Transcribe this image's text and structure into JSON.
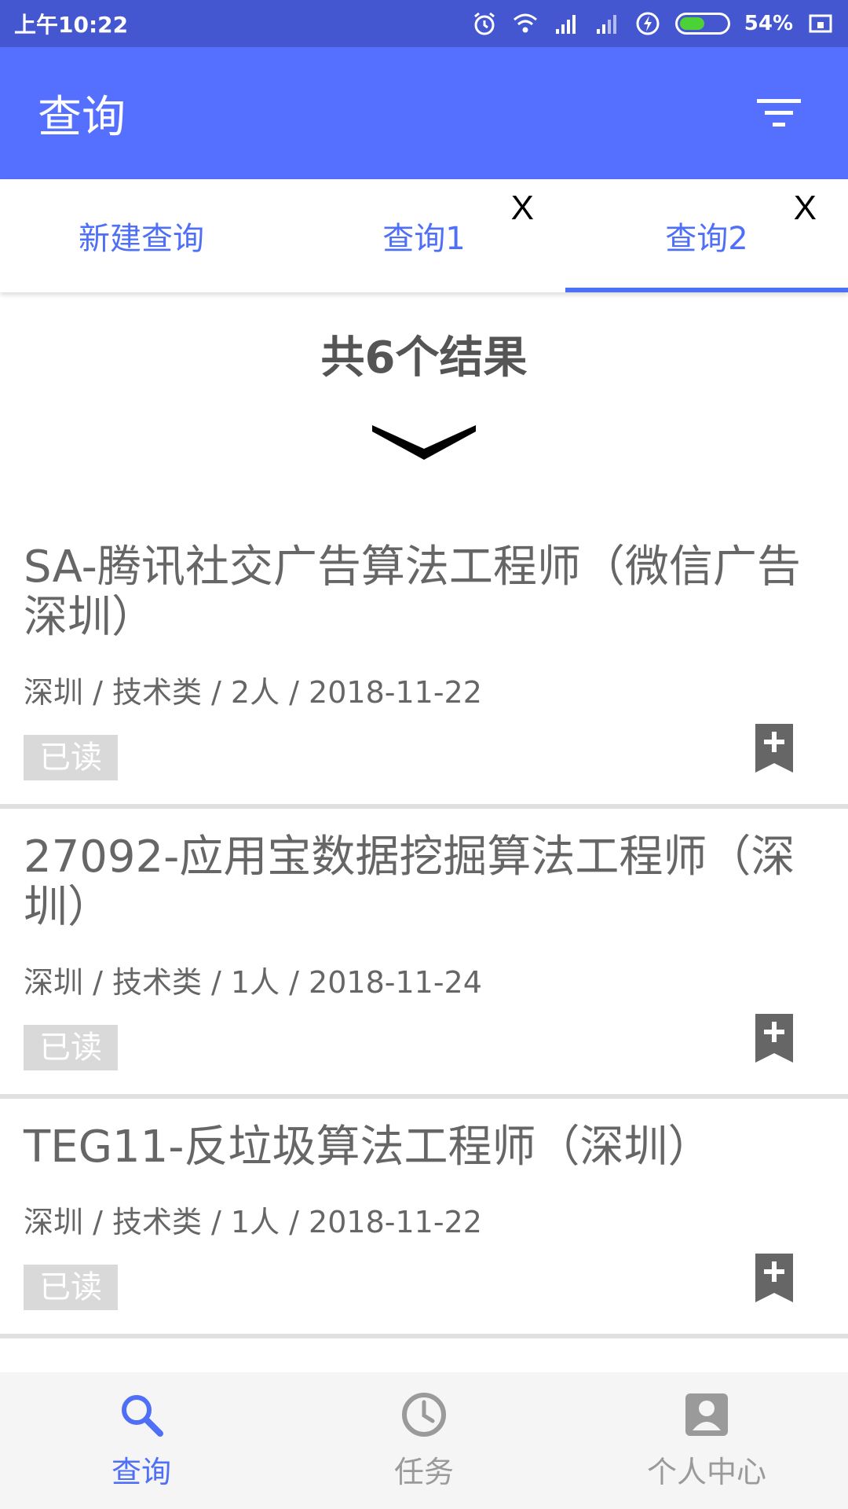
{
  "status_bar": {
    "time": "上午10:22",
    "battery_pct": "54%",
    "battery_level": 0.54
  },
  "app_bar": {
    "title": "查询",
    "filter_icon": "filter-icon"
  },
  "tabs": [
    {
      "label": "新建查询",
      "closable": false,
      "active": false
    },
    {
      "label": "查询1",
      "close_label": "X",
      "closable": true,
      "active": false
    },
    {
      "label": "查询2",
      "close_label": "X",
      "closable": true,
      "active": true
    }
  ],
  "results": {
    "count_text": "共6个结果",
    "expand_icon": "chevron-down-icon"
  },
  "jobs": [
    {
      "title": "SA-腾讯社交广告算法工程师（微信广告深圳）",
      "meta": "深圳 / 技术类 / 2人 / 2018-11-22",
      "badge": "已读"
    },
    {
      "title": "27092-应用宝数据挖掘算法工程师（深圳）",
      "meta": "深圳 / 技术类 / 1人 / 2018-11-24",
      "badge": "已读"
    },
    {
      "title": "TEG11-反垃圾算法工程师（深圳）",
      "meta": "深圳 / 技术类 / 1人 / 2018-11-22",
      "badge": "已读"
    }
  ],
  "bottom_nav": [
    {
      "label": "查询",
      "icon": "search-icon",
      "active": true
    },
    {
      "label": "任务",
      "icon": "clock-icon",
      "active": false
    },
    {
      "label": "个人中心",
      "icon": "person-icon",
      "active": false
    }
  ],
  "colors": {
    "primary": "#5570ff",
    "status_bar": "#4457d0",
    "accent": "#4f6ff7",
    "badge_bg": "#d9d9d9"
  }
}
